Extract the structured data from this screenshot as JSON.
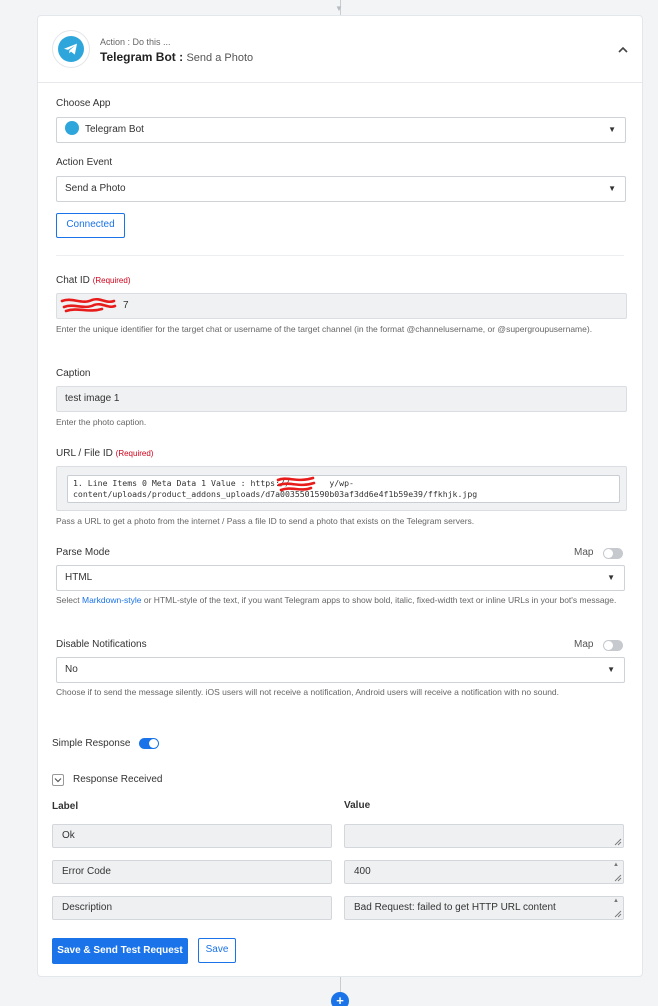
{
  "header": {
    "subtitle": "Action : Do this ...",
    "app_name": "Telegram Bot :",
    "action_name": "Send a Photo"
  },
  "choose_app": {
    "label": "Choose App",
    "value": "Telegram Bot"
  },
  "action_event": {
    "label": "Action Event",
    "value": "Send a Photo"
  },
  "connected_label": "Connected",
  "chat_id": {
    "label": "Chat ID",
    "required": "(Required)",
    "value": "7",
    "help": "Enter the unique identifier for the target chat or username of the target channel (in the format @channelusername, or @supergroupusername)."
  },
  "caption": {
    "label": "Caption",
    "value": "test image 1",
    "help": "Enter the photo caption."
  },
  "url_file": {
    "label": "URL / File ID",
    "required": "(Required)",
    "value_line1": "1. Line Items 0 Meta Data 1 Value : https://        y/wp-",
    "value_line2": "content/uploads/product_addons_uploads/d7a0035501590b03af3dd6e4f1b59e39/ffkhjk.jpg",
    "help": "Pass a URL to get a photo from the internet / Pass a file ID to send a photo that exists on the Telegram servers."
  },
  "parse_mode": {
    "label": "Parse Mode",
    "map_label": "Map",
    "value": "HTML",
    "help_prefix": "Select ",
    "help_link": "Markdown-style",
    "help_suffix": " or HTML-style of the text, if you want Telegram apps to show bold, italic, fixed-width text or inline URLs in your bot's message."
  },
  "disable_notifications": {
    "label": "Disable Notifications",
    "map_label": "Map",
    "value": "No",
    "help": "Choose if to send the message silently. iOS users will not receive a notification, Android users will receive a notification with no sound."
  },
  "simple_response": {
    "label": "Simple Response"
  },
  "response_received": {
    "label": "Response Received",
    "col_label": "Label",
    "col_value": "Value",
    "rows": [
      {
        "label": "Ok",
        "value": ""
      },
      {
        "label": "Error Code",
        "value": "400"
      },
      {
        "label": "Description",
        "value": "Bad Request: failed to get HTTP URL content"
      }
    ]
  },
  "buttons": {
    "save_send": "Save & Send Test Request",
    "save": "Save"
  },
  "add_step": "+",
  "colors": {
    "accent": "#1a73e8",
    "telegram": "#2ea6db",
    "required": "#d0021b"
  }
}
